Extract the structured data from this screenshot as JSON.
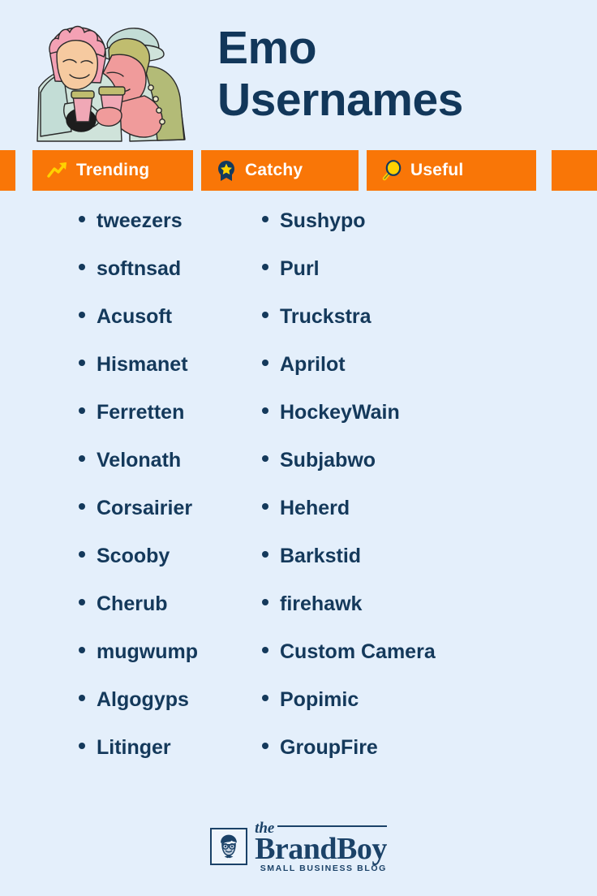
{
  "page": {
    "background_color": "#e4effb",
    "accent_color": "#f97607",
    "text_color": "#14395b",
    "icon_yellow": "#ffd200"
  },
  "header": {
    "title_line1": "Emo",
    "title_line2": "Usernames",
    "illustration_name": "two-people-with-coffee-cups-illustration"
  },
  "badges": [
    {
      "label": "Trending",
      "icon": "trending-up-icon"
    },
    {
      "label": "Catchy",
      "icon": "award-star-badge-icon"
    },
    {
      "label": "Useful",
      "icon": "magnifying-glass-icon"
    }
  ],
  "lists": {
    "left_column": [
      "tweezers",
      "softnsad",
      "Acusoft",
      "Hismanet",
      "Ferretten",
      "Velonath",
      "Corsairier",
      "Scooby",
      "Cherub",
      "mugwump",
      "Algogyps",
      "Litinger"
    ],
    "right_column": [
      "Sushypo",
      "Purl",
      "Truckstra",
      "Aprilot",
      "HockeyWain",
      "Subjabwo",
      "Heherd",
      "Barkstid",
      "firehawk",
      "Custom Camera",
      "Popimic",
      "GroupFire"
    ]
  },
  "footer": {
    "logo_the": "the",
    "logo_brand": "BrandBoy",
    "logo_tagline": "SMALL BUSINESS BLOG",
    "logo_mark_name": "boy-face-with-glasses-icon"
  }
}
